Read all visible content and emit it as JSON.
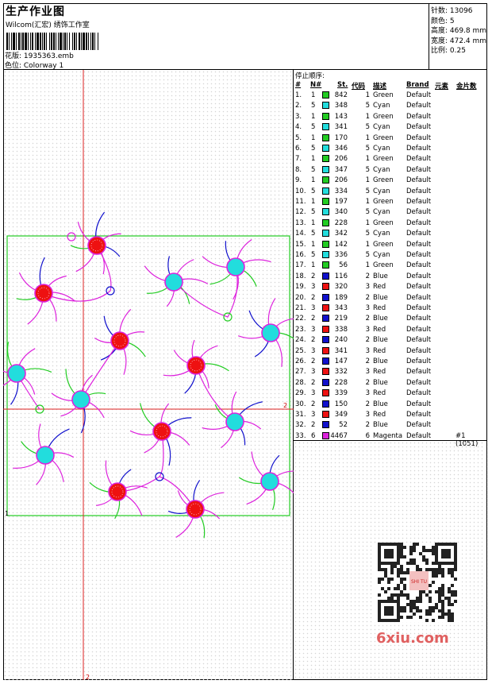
{
  "header": {
    "title": "生产作业图",
    "studio": "Wilcom(汇宏) 绣饰工作室",
    "design_label": "花版: 1935363.emb",
    "colorway_label": "色位: Colorway 1"
  },
  "stats": {
    "stitches": "针数: 13096",
    "colors": "颜色: 5",
    "height": "高度: 469.8 mm",
    "width": "宽度: 472.4 mm",
    "scale": "比例: 0.25"
  },
  "stop_sequence": {
    "title": "停止顺序:",
    "headers": [
      "#",
      "N#",
      "St.",
      "代码",
      "描述",
      "Brand",
      "元素",
      "金片数"
    ],
    "rows": [
      {
        "idx": "1.",
        "n": "1",
        "st": "842",
        "code": "1",
        "desc": "Green",
        "brand": "Default",
        "note": ""
      },
      {
        "idx": "2.",
        "n": "5",
        "st": "348",
        "code": "5",
        "desc": "Cyan",
        "brand": "Default",
        "note": ""
      },
      {
        "idx": "3.",
        "n": "1",
        "st": "143",
        "code": "1",
        "desc": "Green",
        "brand": "Default",
        "note": ""
      },
      {
        "idx": "4.",
        "n": "5",
        "st": "341",
        "code": "5",
        "desc": "Cyan",
        "brand": "Default",
        "note": ""
      },
      {
        "idx": "5.",
        "n": "1",
        "st": "170",
        "code": "1",
        "desc": "Green",
        "brand": "Default",
        "note": ""
      },
      {
        "idx": "6.",
        "n": "5",
        "st": "346",
        "code": "5",
        "desc": "Cyan",
        "brand": "Default",
        "note": ""
      },
      {
        "idx": "7.",
        "n": "1",
        "st": "206",
        "code": "1",
        "desc": "Green",
        "brand": "Default",
        "note": ""
      },
      {
        "idx": "8.",
        "n": "5",
        "st": "347",
        "code": "5",
        "desc": "Cyan",
        "brand": "Default",
        "note": ""
      },
      {
        "idx": "9.",
        "n": "1",
        "st": "206",
        "code": "1",
        "desc": "Green",
        "brand": "Default",
        "note": ""
      },
      {
        "idx": "10.",
        "n": "5",
        "st": "334",
        "code": "5",
        "desc": "Cyan",
        "brand": "Default",
        "note": ""
      },
      {
        "idx": "11.",
        "n": "1",
        "st": "197",
        "code": "1",
        "desc": "Green",
        "brand": "Default",
        "note": ""
      },
      {
        "idx": "12.",
        "n": "5",
        "st": "340",
        "code": "5",
        "desc": "Cyan",
        "brand": "Default",
        "note": ""
      },
      {
        "idx": "13.",
        "n": "1",
        "st": "228",
        "code": "1",
        "desc": "Green",
        "brand": "Default",
        "note": ""
      },
      {
        "idx": "14.",
        "n": "5",
        "st": "342",
        "code": "5",
        "desc": "Cyan",
        "brand": "Default",
        "note": ""
      },
      {
        "idx": "15.",
        "n": "1",
        "st": "142",
        "code": "1",
        "desc": "Green",
        "brand": "Default",
        "note": ""
      },
      {
        "idx": "16.",
        "n": "5",
        "st": "336",
        "code": "5",
        "desc": "Cyan",
        "brand": "Default",
        "note": ""
      },
      {
        "idx": "17.",
        "n": "1",
        "st": "56",
        "code": "1",
        "desc": "Green",
        "brand": "Default",
        "note": ""
      },
      {
        "idx": "18.",
        "n": "2",
        "st": "116",
        "code": "2",
        "desc": "Blue",
        "brand": "Default",
        "note": ""
      },
      {
        "idx": "19.",
        "n": "3",
        "st": "320",
        "code": "3",
        "desc": "Red",
        "brand": "Default",
        "note": ""
      },
      {
        "idx": "20.",
        "n": "2",
        "st": "189",
        "code": "2",
        "desc": "Blue",
        "brand": "Default",
        "note": ""
      },
      {
        "idx": "21.",
        "n": "3",
        "st": "343",
        "code": "3",
        "desc": "Red",
        "brand": "Default",
        "note": ""
      },
      {
        "idx": "22.",
        "n": "2",
        "st": "219",
        "code": "2",
        "desc": "Blue",
        "brand": "Default",
        "note": ""
      },
      {
        "idx": "23.",
        "n": "3",
        "st": "338",
        "code": "3",
        "desc": "Red",
        "brand": "Default",
        "note": ""
      },
      {
        "idx": "24.",
        "n": "2",
        "st": "240",
        "code": "2",
        "desc": "Blue",
        "brand": "Default",
        "note": ""
      },
      {
        "idx": "25.",
        "n": "3",
        "st": "341",
        "code": "3",
        "desc": "Red",
        "brand": "Default",
        "note": ""
      },
      {
        "idx": "26.",
        "n": "2",
        "st": "147",
        "code": "2",
        "desc": "Blue",
        "brand": "Default",
        "note": ""
      },
      {
        "idx": "27.",
        "n": "3",
        "st": "332",
        "code": "3",
        "desc": "Red",
        "brand": "Default",
        "note": ""
      },
      {
        "idx": "28.",
        "n": "2",
        "st": "228",
        "code": "2",
        "desc": "Blue",
        "brand": "Default",
        "note": ""
      },
      {
        "idx": "29.",
        "n": "3",
        "st": "339",
        "code": "3",
        "desc": "Red",
        "brand": "Default",
        "note": ""
      },
      {
        "idx": "30.",
        "n": "2",
        "st": "150",
        "code": "2",
        "desc": "Blue",
        "brand": "Default",
        "note": ""
      },
      {
        "idx": "31.",
        "n": "3",
        "st": "349",
        "code": "3",
        "desc": "Red",
        "brand": "Default",
        "note": ""
      },
      {
        "idx": "32.",
        "n": "2",
        "st": "52",
        "code": "2",
        "desc": "Blue",
        "brand": "Default",
        "note": ""
      },
      {
        "idx": "33.",
        "n": "6",
        "st": "4467",
        "code": "6",
        "desc": "Magenta",
        "brand": "Default",
        "note": "#1 (1051)"
      }
    ]
  },
  "thread_colors": {
    "1": "#22cc22",
    "2": "#1010cc",
    "3": "#ee1111",
    "5": "#22dddd",
    "6": "#dd22dd"
  },
  "design_markers": {
    "left_mark": "1",
    "right_mark": "2",
    "bottom_mark": "2"
  },
  "watermark": "6xiu.com",
  "qr_stamp": "SHI TU"
}
